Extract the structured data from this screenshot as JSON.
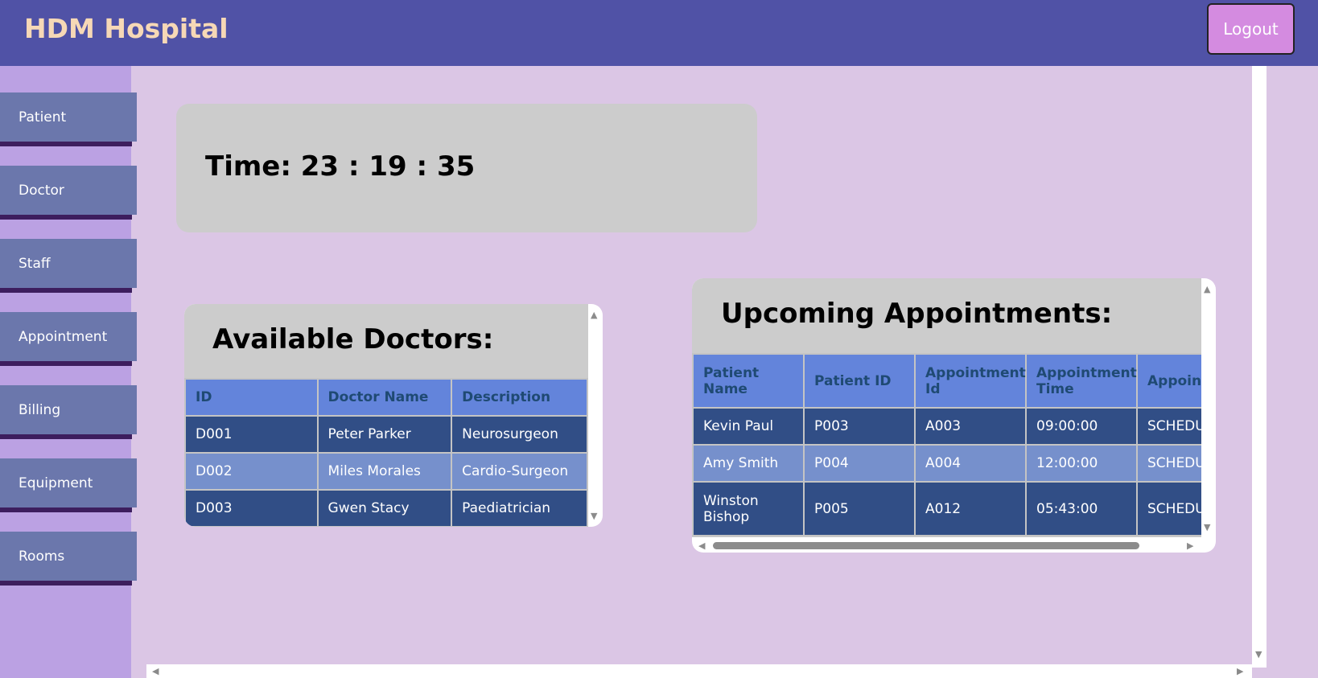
{
  "header": {
    "brand": "HDM Hospital",
    "logout_label": "Logout"
  },
  "sidebar": {
    "items": [
      {
        "label": "Patient"
      },
      {
        "label": "Doctor"
      },
      {
        "label": "Staff"
      },
      {
        "label": "Appointment"
      },
      {
        "label": "Billing"
      },
      {
        "label": "Equipment"
      },
      {
        "label": "Rooms"
      }
    ]
  },
  "clock": {
    "text": "Time: 23 : 19 : 35"
  },
  "doctors": {
    "title": "Available Doctors:",
    "columns": [
      "ID",
      "Doctor Name",
      "Description"
    ],
    "rows": [
      [
        "D001",
        "Peter Parker",
        "Neurosurgeon"
      ],
      [
        "D002",
        "Miles Morales",
        "Cardio-Surgeon"
      ],
      [
        "D003",
        "Gwen Stacy",
        "Paediatrician"
      ]
    ]
  },
  "appointments": {
    "title": "Upcoming Appointments:",
    "columns": [
      "Patient Name",
      "Patient ID",
      "Appointment Id",
      "Appointment Time",
      "Appoint Status"
    ],
    "rows": [
      [
        "Kevin Paul",
        "P003",
        "A003",
        "09:00:00",
        "SCHEDU"
      ],
      [
        "Amy Smith",
        "P004",
        "A004",
        "12:00:00",
        "SCHEDU"
      ],
      [
        "Winston Bishop",
        "P005",
        "A012",
        "05:43:00",
        "SCHEDU"
      ]
    ]
  },
  "colors": {
    "header_bg": "#5052a6",
    "brand_text": "#f6d8b6",
    "logout_bg": "#d48be0",
    "sidebar_bg": "#bba1e3",
    "sidebar_button": "#6b77ac",
    "main_bg": "#dbc6e5",
    "table_header": "#6384db",
    "row_dark": "#314e86",
    "row_light": "#7690cc"
  }
}
